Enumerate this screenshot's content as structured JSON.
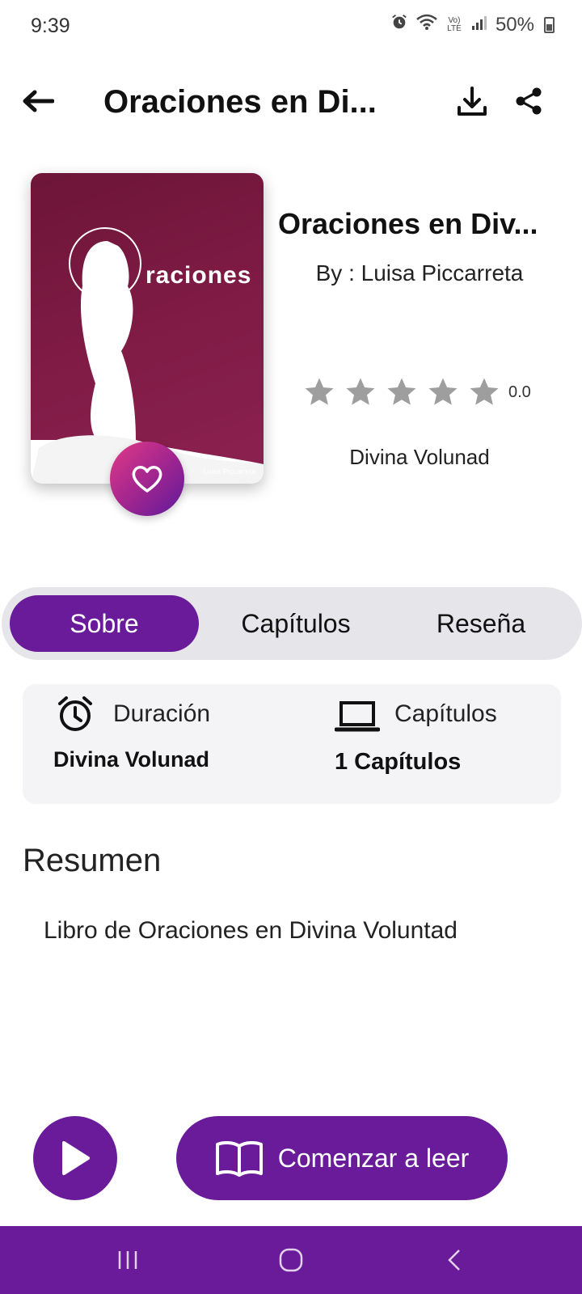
{
  "status_bar": {
    "time": "9:39",
    "battery": "50%",
    "network_label": "Vo) LTE"
  },
  "app_bar": {
    "title": "Oraciones en Di...",
    "back_icon": "arrow-left-icon",
    "download_icon": "download-icon",
    "share_icon": "share-icon"
  },
  "book": {
    "cover_word": "raciones",
    "cover_author": "Luisa Piccarreta",
    "title": "Oraciones en Div...",
    "author": "By : Luisa Piccarreta",
    "rating": "0.0",
    "stars_total": 5,
    "category": "Divina Volunad"
  },
  "tabs": [
    {
      "label": "Sobre",
      "active": true
    },
    {
      "label": "Capítulos",
      "active": false
    },
    {
      "label": "Reseña",
      "active": false
    }
  ],
  "info": {
    "duration_label": "Duración",
    "duration_value": "Divina Volunad",
    "chapters_label": "Capítulos",
    "chapters_value": "1 Capítulos"
  },
  "summary": {
    "heading": "Resumen",
    "text": "Libro de Oraciones en Divina Voluntad"
  },
  "actions": {
    "read_label": "Comenzar a leer"
  },
  "colors": {
    "accent": "#6a1b9a",
    "cover": "#7f1b45",
    "star": "#9e9e9e"
  }
}
